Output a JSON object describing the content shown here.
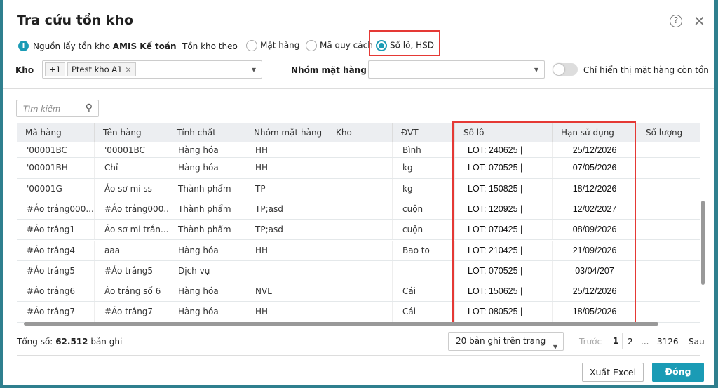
{
  "title": "Tra cứu tồn kho",
  "source": {
    "label": "Nguồn lấy tồn kho",
    "value": "AMIS Kế toán"
  },
  "stock_by": {
    "label": "Tồn kho theo",
    "options": [
      "Mặt hàng",
      "Mã quy cách",
      "Số lô, HSD"
    ],
    "selected": "Số lô, HSD"
  },
  "kho": {
    "label": "Kho",
    "extra_count": "+1",
    "chip": "Ptest kho A1"
  },
  "nhom": {
    "label": "Nhóm mặt hàng",
    "value": ""
  },
  "toggle": {
    "label": "Chỉ hiển thị mặt hàng còn tồn",
    "on": false
  },
  "search": {
    "placeholder": "Tìm kiếm"
  },
  "columns": [
    "Mã hàng",
    "Tên hàng",
    "Tính chất",
    "Nhóm mặt hàng",
    "Kho",
    "ĐVT",
    "Số lô",
    "Hạn sử dụng",
    "Số lượng"
  ],
  "rows": [
    [
      "'00001BC",
      "'00001BC",
      "Hàng hóa",
      "HH",
      "",
      "Bình",
      "LOT: 240625 |",
      "25/12/2026",
      ""
    ],
    [
      "'00001BH",
      "Chỉ",
      "Hàng hóa",
      "HH",
      "",
      "kg",
      "LOT: 070525 |",
      "07/05/2026",
      ""
    ],
    [
      "'00001G",
      "Áo sơ mi ss",
      "Thành phẩm",
      "TP",
      "",
      "kg",
      "LOT: 150825 |",
      "18/12/2026",
      ""
    ],
    [
      "#Áo trắng000...",
      "#Áo trắng000...",
      "Thành phẩm",
      "TP;asd",
      "",
      "cuộn",
      "LOT: 120925 |",
      "12/02/2027",
      ""
    ],
    [
      "#Áo trắng1",
      "Áo sơ mi trắn...",
      "Thành phẩm",
      "TP;asd",
      "",
      "cuộn",
      "LOT: 070425 |",
      "08/09/2026",
      ""
    ],
    [
      "#Áo trắng4",
      "aaa",
      "Hàng hóa",
      "HH",
      "",
      "Bao to",
      "LOT: 210425 |",
      "21/09/2026",
      ""
    ],
    [
      "#Áo trắng5",
      "#Áo trắng5",
      "Dịch vụ",
      "",
      "",
      "",
      "LOT: 070525 |",
      "03/04/207",
      ""
    ],
    [
      "#Áo trắng6",
      "Áo trắng số 6",
      "Hàng hóa",
      "NVL",
      "",
      "Cái",
      "LOT: 150625 |",
      "25/12/2026",
      ""
    ],
    [
      "#Áo trắng7",
      "#Áo trắng7",
      "Hàng hóa",
      "HH",
      "",
      "Cái",
      "LOT: 080525 |",
      "18/05/2026",
      ""
    ]
  ],
  "footer": {
    "total_label": "Tổng số:",
    "total": "62.512",
    "total_unit": "bản ghi",
    "page_size": "20 bản ghi trên trang",
    "prev": "Trước",
    "pages": [
      "1",
      "2",
      "...",
      "3126"
    ],
    "current_page": "1",
    "next": "Sau"
  },
  "buttons": {
    "export": "Xuất Excel",
    "close": "Đóng"
  },
  "colors": {
    "accent": "#1a9bb5",
    "highlight": "#e53935"
  }
}
